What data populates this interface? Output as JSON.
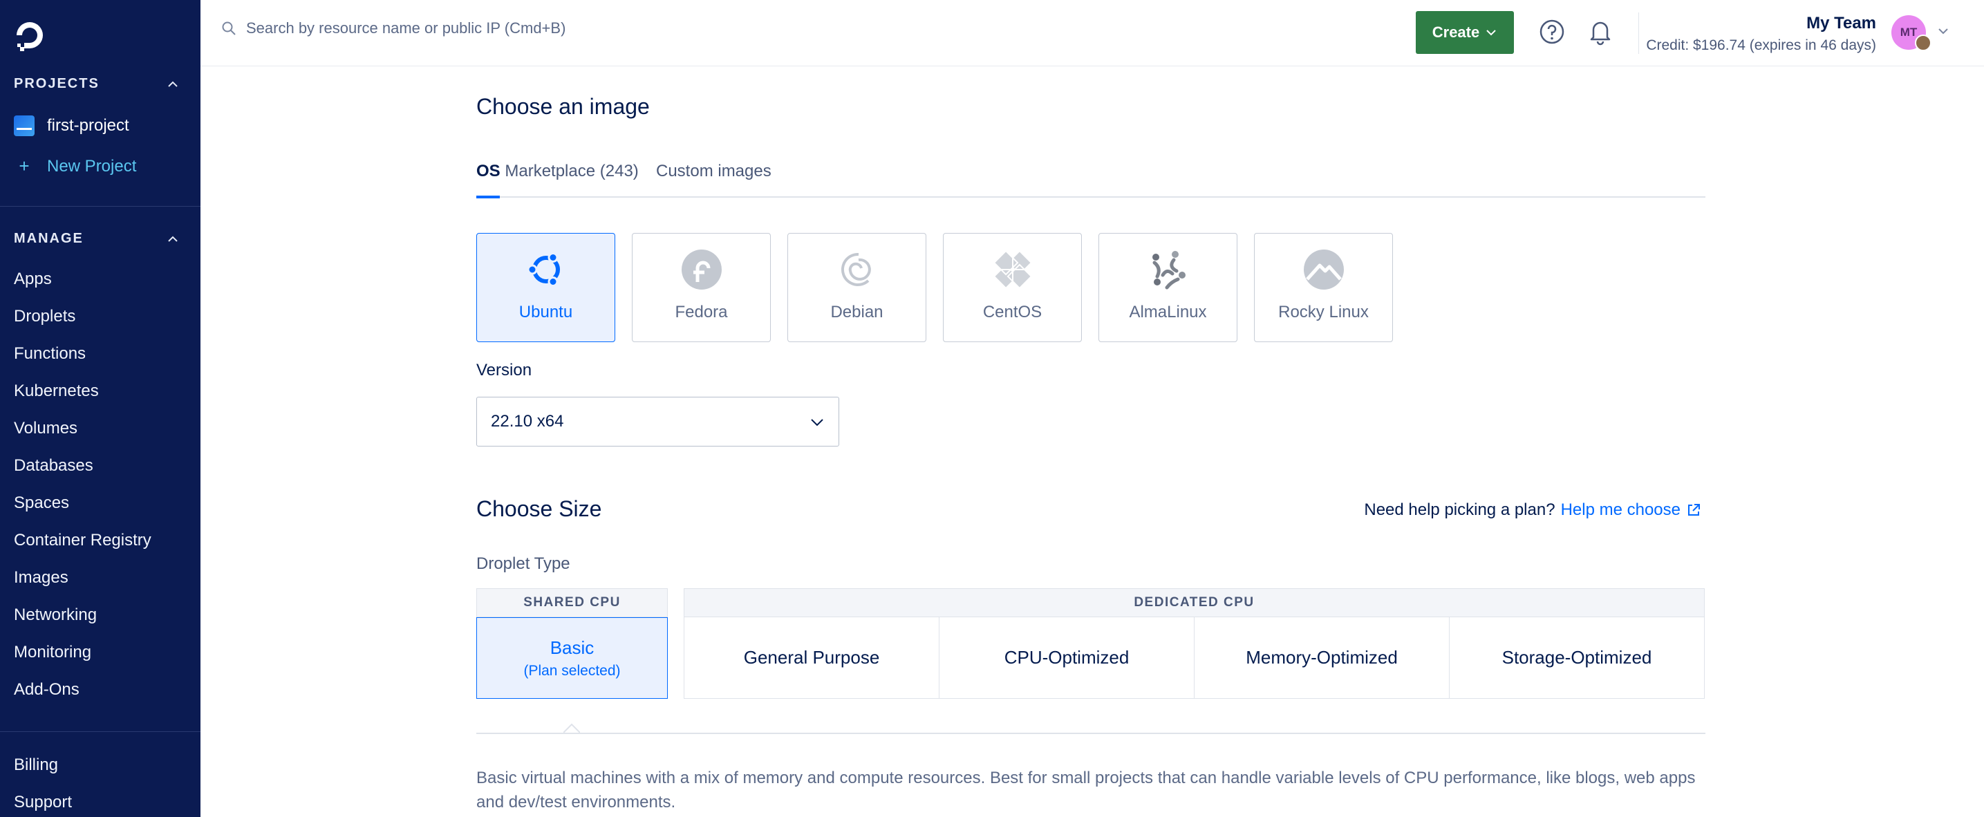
{
  "sidebar": {
    "projects_heading": "PROJECTS",
    "projects": [
      {
        "label": "first-project"
      }
    ],
    "new_project_label": "New Project",
    "manage_heading": "MANAGE",
    "manage_items": [
      {
        "label": "Apps"
      },
      {
        "label": "Droplets"
      },
      {
        "label": "Functions"
      },
      {
        "label": "Kubernetes"
      },
      {
        "label": "Volumes"
      },
      {
        "label": "Databases"
      },
      {
        "label": "Spaces"
      },
      {
        "label": "Container Registry"
      },
      {
        "label": "Images"
      },
      {
        "label": "Networking"
      },
      {
        "label": "Monitoring"
      },
      {
        "label": "Add-Ons"
      }
    ],
    "bottom_items": [
      {
        "label": "Billing"
      },
      {
        "label": "Support"
      }
    ]
  },
  "topbar": {
    "search_placeholder": "Search by resource name or public IP (Cmd+B)",
    "create_label": "Create",
    "team_name": "My Team",
    "credit_text": "Credit: $196.74 (expires in 46 days)",
    "avatar_initials": "MT"
  },
  "image": {
    "title": "Choose an image",
    "tab_os_prefix": "OS",
    "tab_marketplace": "Marketplace (243)",
    "tab_custom": "Custom images",
    "os_options": [
      {
        "label": "Ubuntu",
        "icon": "ubuntu-icon",
        "selected": true
      },
      {
        "label": "Fedora",
        "icon": "fedora-icon"
      },
      {
        "label": "Debian",
        "icon": "debian-icon"
      },
      {
        "label": "CentOS",
        "icon": "centos-icon"
      },
      {
        "label": "AlmaLinux",
        "icon": "almalinux-icon"
      },
      {
        "label": "Rocky Linux",
        "icon": "rocky-linux-icon"
      }
    ],
    "version_label": "Version",
    "version_value": "22.10 x64"
  },
  "size": {
    "title": "Choose Size",
    "help_text": "Need help picking a plan?",
    "help_link": "Help me choose",
    "droplet_type_label": "Droplet Type",
    "shared_heading": "SHARED CPU",
    "basic_label": "Basic",
    "basic_sub": "(Plan selected)",
    "dedicated_heading": "DEDICATED CPU",
    "dedicated_options": [
      {
        "label": "General Purpose"
      },
      {
        "label": "CPU-Optimized"
      },
      {
        "label": "Memory-Optimized"
      },
      {
        "label": "Storage-Optimized"
      }
    ],
    "description": "Basic virtual machines with a mix of memory and compute resources. Best for small projects that can handle variable levels of CPU performance, like blogs, web apps and dev/test environments."
  },
  "colors": {
    "sidebar_bg": "#0b1b52",
    "accent_blue": "#0069ff",
    "create_green": "#2e7d45",
    "avatar_pink": "#e887f0"
  }
}
